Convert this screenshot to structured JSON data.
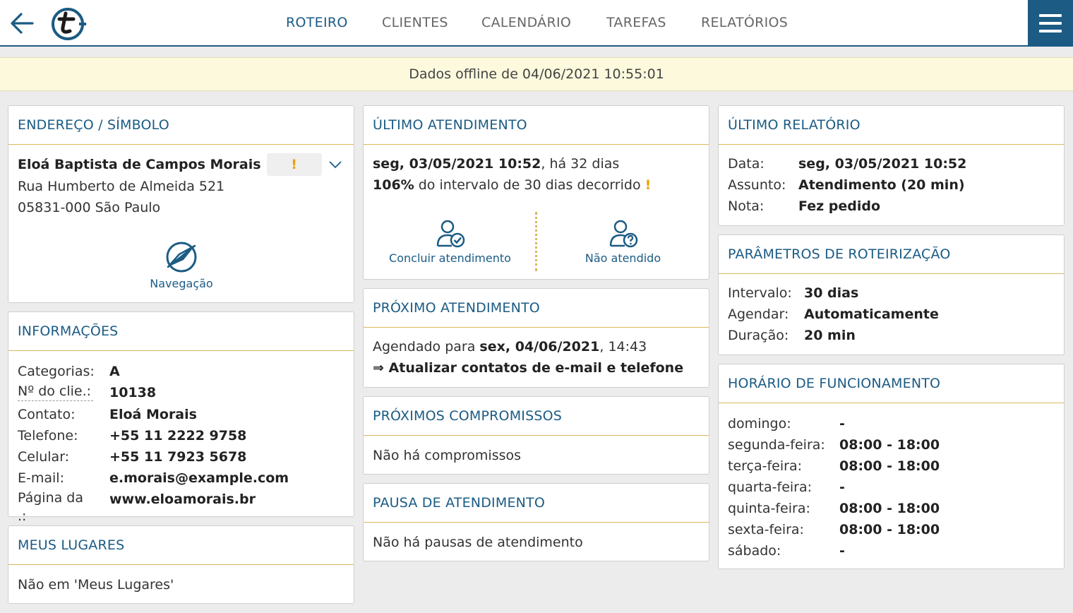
{
  "nav": {
    "tabs": [
      {
        "label": "ROTEIRO",
        "active": true
      },
      {
        "label": "CLIENTES"
      },
      {
        "label": "CALENDÁRIO"
      },
      {
        "label": "TAREFAS"
      },
      {
        "label": "RELATÓRIOS"
      }
    ],
    "icons": {
      "back": "arrow-left-icon",
      "logo": "t-logo-icon",
      "menu": "hamburger-menu-icon"
    }
  },
  "offline_banner": "Dados offline de 04/06/2021 10:55:01",
  "address": {
    "title": "ENDEREÇO / SÍMBOLO",
    "name": "Eloá Baptista de Campos Morais",
    "warn": "!",
    "street": "Rua Humberto de Almeida 521",
    "city": "05831-000 São Paulo",
    "nav_label": "Navegação"
  },
  "info": {
    "title": "INFORMAÇÕES",
    "rows": [
      {
        "key": "Categorias:",
        "value": "A"
      },
      {
        "key": "Nº do clie.:",
        "value": "10138"
      },
      {
        "key": "Contato:",
        "value": "Eloá Morais"
      },
      {
        "key": "Telefone:",
        "value": "+55 11 2222 9758"
      },
      {
        "key": "Celular:",
        "value": "+55 11 7923 5678"
      },
      {
        "key": "E-mail:",
        "value": "e.morais@example.com"
      },
      {
        "key": "Página da .:",
        "value": "www.eloamorais.br"
      }
    ]
  },
  "places": {
    "title": "MEUS LUGARES",
    "text": "Não em 'Meus Lugares'"
  },
  "last_visit": {
    "title": "ÚLTIMO ATENDIMENTO",
    "date": "seg, 03/05/2021 10:52",
    "ago": ", há 32 dias",
    "percent": "106%",
    "interval_text": " do intervalo de 30 dias decorrido ",
    "warn": "!",
    "action_done": "Concluir atendimento",
    "action_missed": "Não atendido"
  },
  "next_visit": {
    "title": "PRÓXIMO ATENDIMENTO",
    "prefix": "Agendado para ",
    "date": "sex, 04/06/2021",
    "time": ", 14:43",
    "task": "⇒ Atualizar contatos de e-mail e telefone"
  },
  "appointments": {
    "title": "PRÓXIMOS COMPROMISSOS",
    "text": "Não há compromissos"
  },
  "pause": {
    "title": "PAUSA DE ATENDIMENTO",
    "text": "Não há pausas de atendimento"
  },
  "last_report": {
    "title": "ÚLTIMO RELATÓRIO",
    "rows": [
      {
        "key": "Data:",
        "value": "seg, 03/05/2021 10:52"
      },
      {
        "key": "Assunto:",
        "value": "Atendimento (20 min)"
      },
      {
        "key": "Nota:",
        "value": "Fez pedido"
      }
    ]
  },
  "routing": {
    "title": "PARÂMETROS DE ROTEIRIZAÇÃO",
    "rows": [
      {
        "key": "Intervalo:",
        "value": "30 dias"
      },
      {
        "key": "Agendar:",
        "value": "Automaticamente"
      },
      {
        "key": "Duração:",
        "value": "20 min"
      }
    ]
  },
  "hours": {
    "title": "HORÁRIO DE FUNCIONAMENTO",
    "rows": [
      {
        "key": "domingo:",
        "value": "-"
      },
      {
        "key": "segunda-feira:",
        "value": "08:00 - 18:00"
      },
      {
        "key": "terça-feira:",
        "value": "08:00 - 18:00"
      },
      {
        "key": "quarta-feira:",
        "value": "-"
      },
      {
        "key": "quinta-feira:",
        "value": "08:00 - 18:00"
      },
      {
        "key": "sexta-feira:",
        "value": "08:00 - 18:00"
      },
      {
        "key": "sábado:",
        "value": "-"
      }
    ]
  }
}
